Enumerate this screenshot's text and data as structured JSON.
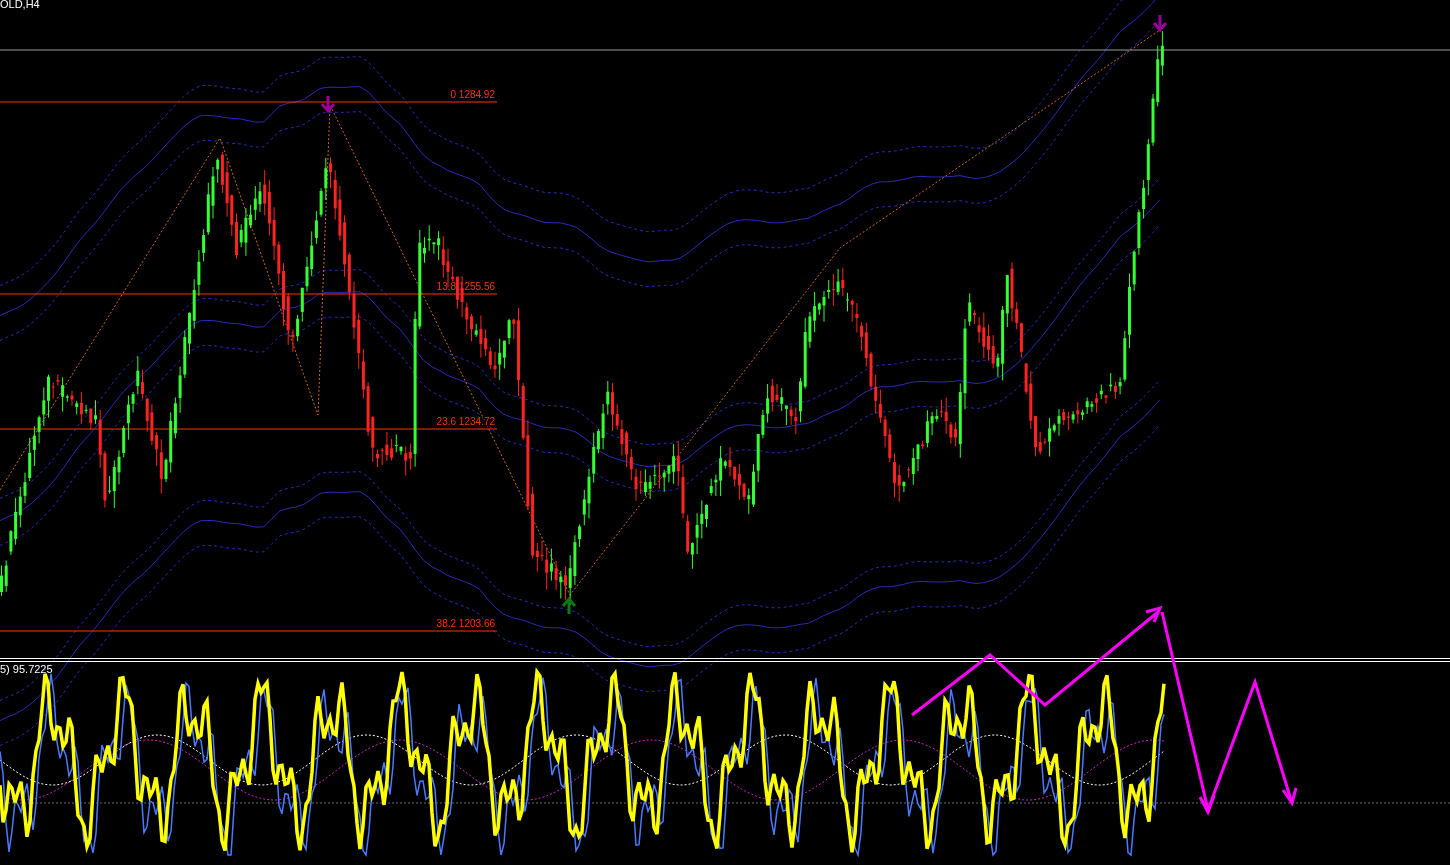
{
  "chart": {
    "symbol_label": "OLD,H4",
    "fib_levels": [
      {
        "label": "0 1284.92"
      },
      {
        "label": "13.8 1255.56"
      },
      {
        "label": "23.6 1234.72"
      },
      {
        "label": "38.2 1203.66"
      }
    ]
  },
  "indicator": {
    "label": "5) 95.7225"
  }
}
